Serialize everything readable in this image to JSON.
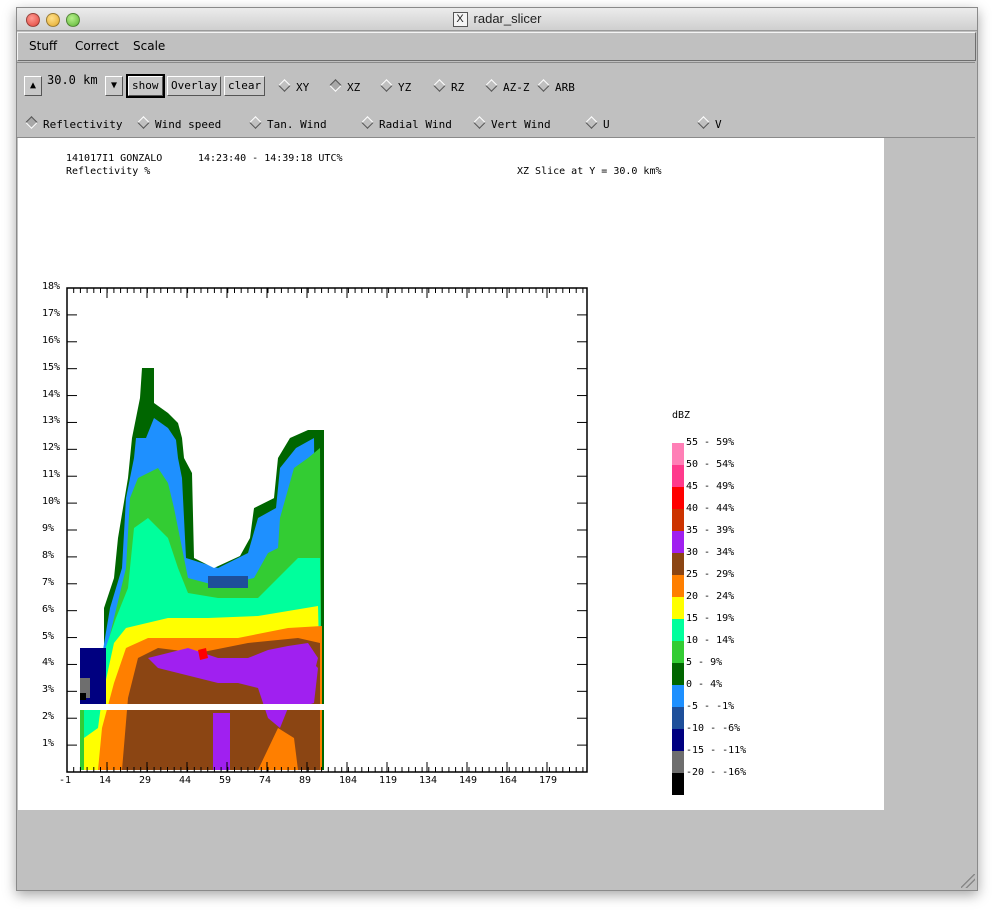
{
  "window": {
    "title": "radar_slicer",
    "icon": "x-window-icon"
  },
  "menu": [
    "Stuff",
    "Correct",
    "Scale"
  ],
  "toolbar": {
    "height_value": "30.0 km",
    "show_label": "show",
    "overlay_label": "Overlay",
    "clear_label": "clear",
    "slice_modes": [
      {
        "label": "XY",
        "selected": false
      },
      {
        "label": "XZ",
        "selected": true
      },
      {
        "label": "YZ",
        "selected": false
      },
      {
        "label": "RZ",
        "selected": false
      },
      {
        "label": "AZ-Z",
        "selected": false
      },
      {
        "label": "ARB",
        "selected": false
      }
    ],
    "fields": [
      {
        "label": "Reflectivity",
        "selected": true
      },
      {
        "label": "Wind speed",
        "selected": false
      },
      {
        "label": "Tan. Wind",
        "selected": false
      },
      {
        "label": "Radial Wind",
        "selected": false
      },
      {
        "label": "Vert Wind",
        "selected": false
      },
      {
        "label": "U",
        "selected": false
      },
      {
        "label": "V",
        "selected": false
      }
    ]
  },
  "plot": {
    "flight_id": "141017I1 GONZALO",
    "time_range": "14:23:40 - 14:39:18 UTC%",
    "field_name": "Reflectivity %",
    "slice_desc": "XZ Slice at Y = 30.0 km%",
    "yticks": [
      "18%",
      "17%",
      "16%",
      "15%",
      "14%",
      "13%",
      "12%",
      "11%",
      "10%",
      "9%",
      "8%",
      "7%",
      "6%",
      "5%",
      "4%",
      "3%",
      "2%",
      "1%"
    ],
    "xticks": [
      "-1",
      "14",
      "29",
      "44",
      "59",
      "74",
      "89",
      "104",
      "119",
      "134",
      "149",
      "164",
      "179"
    ]
  },
  "legend": {
    "title": "dBZ",
    "items": [
      {
        "label": "55 - 59%",
        "color": "#ff7fb6"
      },
      {
        "label": "50 - 54%",
        "color": "#ff3a8c"
      },
      {
        "label": "45 - 49%",
        "color": "#ff0000"
      },
      {
        "label": "40 - 44%",
        "color": "#cc3300"
      },
      {
        "label": "35 - 39%",
        "color": "#a020f0"
      },
      {
        "label": "30 - 34%",
        "color": "#8b4513"
      },
      {
        "label": "25 - 29%",
        "color": "#ff7f00"
      },
      {
        "label": "20 - 24%",
        "color": "#ffff00"
      },
      {
        "label": "15 - 19%",
        "color": "#00ff9c"
      },
      {
        "label": "10 - 14%",
        "color": "#33cc33"
      },
      {
        "label": "5 - 9%",
        "color": "#006600"
      },
      {
        "label": "0 - 4%",
        "color": "#1e90ff"
      },
      {
        "label": "-5 - -1%",
        "color": "#1e4f9a"
      },
      {
        "label": "-10 - -6%",
        "color": "#000080"
      },
      {
        "label": "-15 - -11%",
        "color": "#6e6e6e"
      },
      {
        "label": "-20 - -16%",
        "color": "#000000"
      }
    ]
  }
}
